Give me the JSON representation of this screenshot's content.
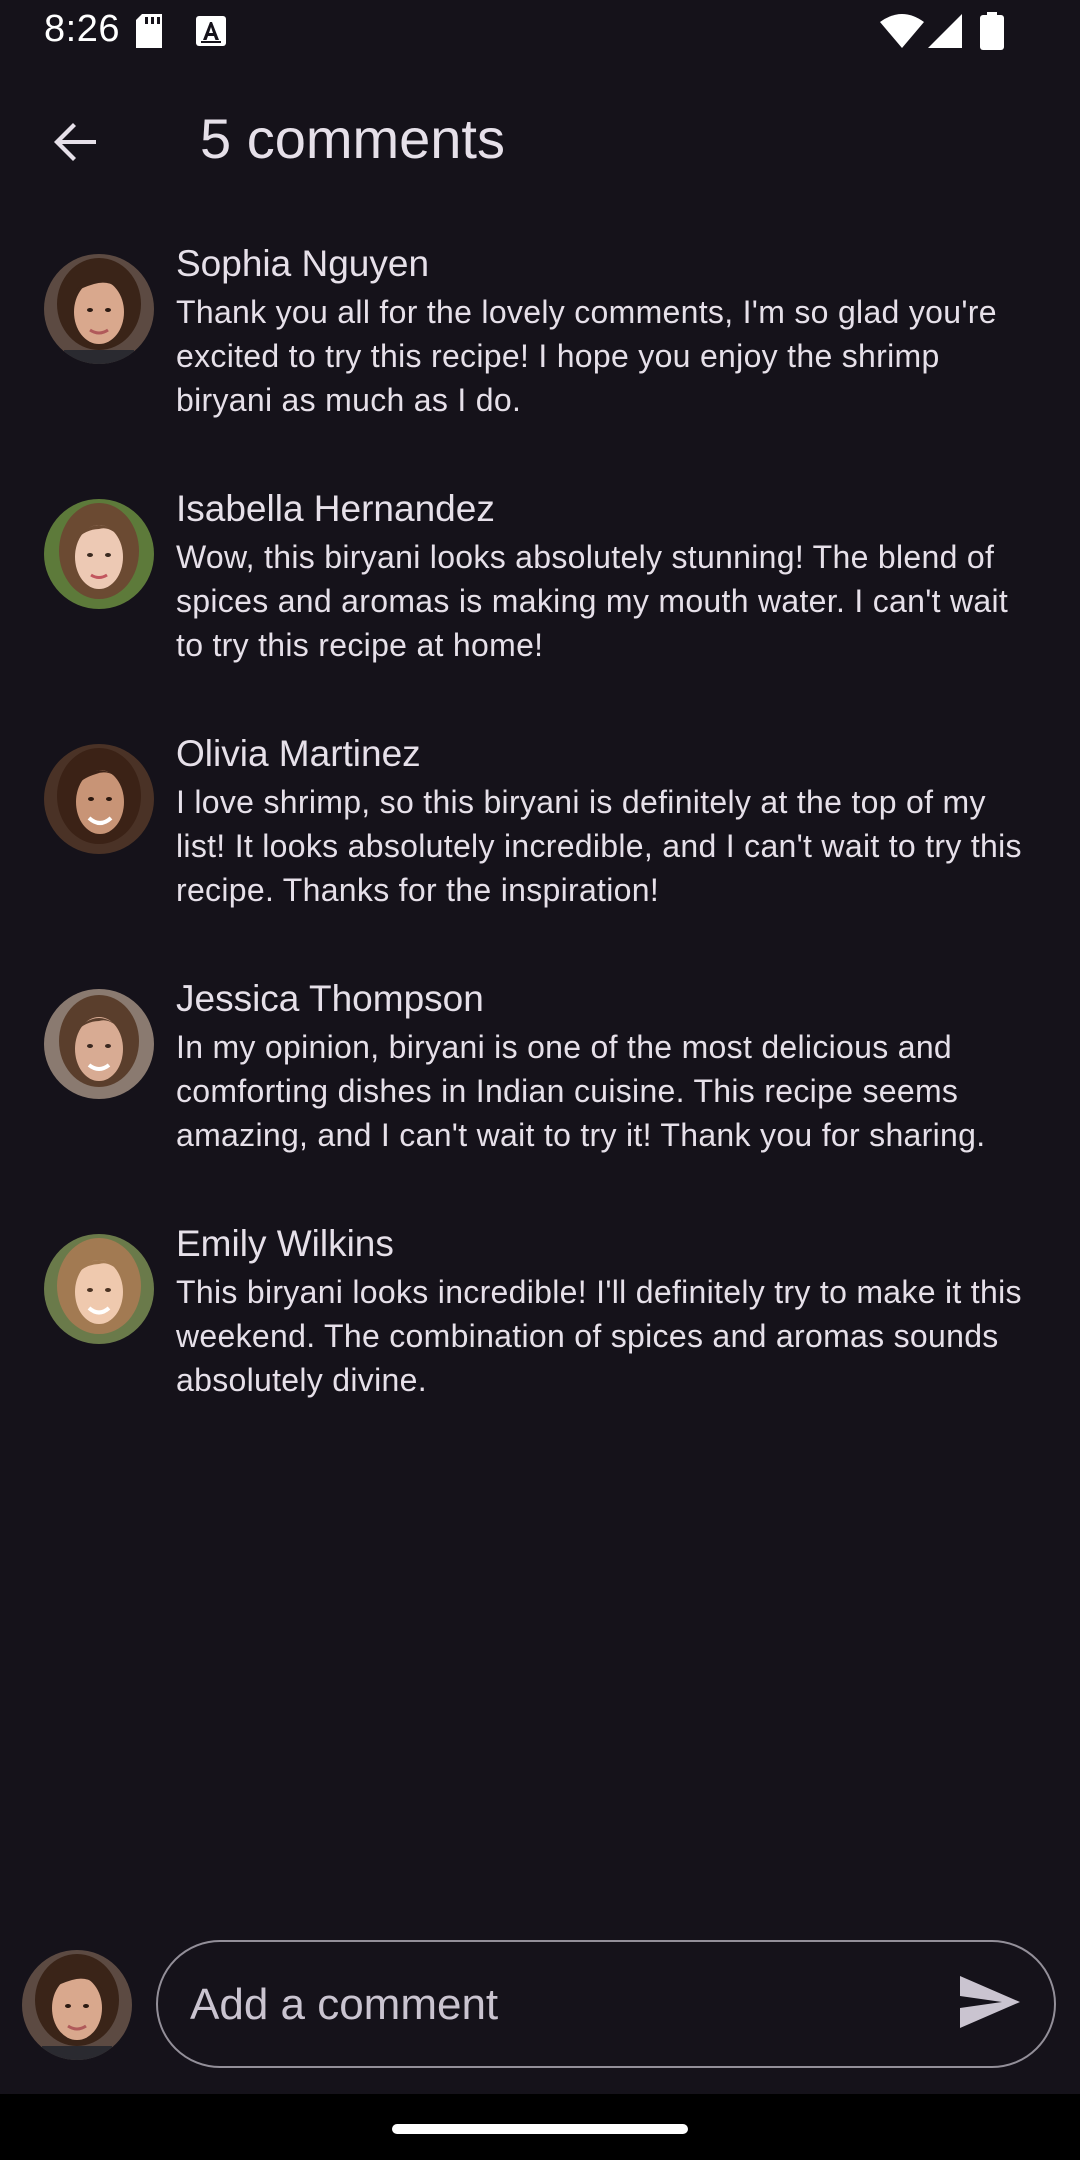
{
  "status_bar": {
    "time": "8:26",
    "icons": [
      "sd-card-icon",
      "keyboard-a-icon",
      "wifi-icon",
      "signal-icon",
      "battery-icon"
    ]
  },
  "header": {
    "title": "5 comments",
    "back_icon": "arrow-back-icon"
  },
  "comments": [
    {
      "author": "Sophia Nguyen",
      "text": "Thank you all for the lovely comments, I'm so glad you're excited to try this recipe! I hope you enjoy the shrimp biryani as much as I do."
    },
    {
      "author": "Isabella Hernandez",
      "text": "Wow, this biryani looks absolutely stunning! The blend of spices and aromas is making my mouth water. I can't wait to try this recipe at home!"
    },
    {
      "author": "Olivia Martinez",
      "text": "I love shrimp, so this biryani is definitely at the top of my list! It looks absolutely incredible, and I can't wait to try this recipe. Thanks for the inspiration!"
    },
    {
      "author": "Jessica Thompson",
      "text": "In my opinion, biryani is one of the most delicious and comforting dishes in Indian cuisine. This recipe seems amazing, and I can't wait to try it! Thank you for sharing."
    },
    {
      "author": "Emily Wilkins",
      "text": "This biryani looks incredible! I'll definitely try to make it this weekend. The combination of spices and aromas sounds absolutely divine."
    }
  ],
  "composer": {
    "placeholder": "Add a comment",
    "value": "",
    "send_icon": "send-icon"
  },
  "colors": {
    "background": "#15121a",
    "text": "#e6e0e9",
    "outline": "#938f99"
  }
}
